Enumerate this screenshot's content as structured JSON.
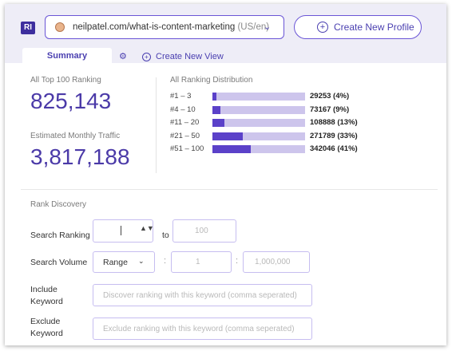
{
  "header": {
    "logo": "RI",
    "url": "neilpatel.com/what-is-content-marketing",
    "locale": "(US/en)",
    "create_profile": "Create New Profile"
  },
  "tabs": {
    "summary": "Summary",
    "create_view": "Create New View"
  },
  "stats": {
    "top100_label": "All Top 100 Ranking",
    "top100_value": "825,143",
    "traffic_label": "Estimated Monthly Traffic",
    "traffic_value": "3,817,188"
  },
  "distribution": {
    "title": "All Ranking Distribution",
    "rows": [
      {
        "range": "#1 – 3",
        "count": "29253 (4%)",
        "percent": 4
      },
      {
        "range": "#4 – 10",
        "count": "73167 (9%)",
        "percent": 9
      },
      {
        "range": "#11 – 20",
        "count": "108888 (13%)",
        "percent": 13
      },
      {
        "range": "#21 – 50",
        "count": "271789 (33%)",
        "percent": 33
      },
      {
        "range": "#51 – 100",
        "count": "342046 (41%)",
        "percent": 41
      }
    ]
  },
  "rank_discovery": {
    "title": "Rank Discovery",
    "search_ranking": {
      "label": "Search Ranking",
      "from_value": "",
      "to_label": "to",
      "to_placeholder": "100"
    },
    "search_volume": {
      "label": "Search Volume",
      "mode": "Range",
      "min_placeholder": "1",
      "max_placeholder": "1,000,000",
      "separator": ":"
    },
    "include": {
      "label": "Include Keyword",
      "placeholder": "Discover ranking with this keyword (comma seperated)"
    },
    "exclude": {
      "label": "Exclude Keyword",
      "placeholder": "Exclude ranking with this keyword (comma seperated)"
    }
  },
  "colors": {
    "accent": "#4b3aa8",
    "bar_fill": "#5b41c9",
    "bar_track": "#cdc5ec",
    "header_bg": "#eeedf7"
  }
}
